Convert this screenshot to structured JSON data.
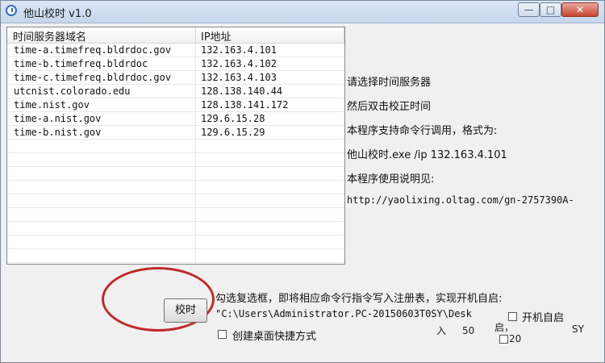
{
  "window": {
    "title": "他山校时 v1.0",
    "controls": {
      "minimize": "—",
      "maximize": "□",
      "close": "✕"
    }
  },
  "table": {
    "headers": [
      "时间服务器域名",
      "IP地址"
    ],
    "rows": [
      [
        "time-a.timefreq.bldrdoc.gov",
        "132.163.4.101"
      ],
      [
        "time-b.timefreq.bldrdoc",
        "132.163.4.102"
      ],
      [
        "time-c.timefreq.bldrdoc.gov",
        "132.163.4.103"
      ],
      [
        "utcnist.colorado.edu",
        "128.138.140.44"
      ],
      [
        "time.nist.gov",
        "128.138.141.172"
      ],
      [
        "time-a.nist.gov",
        "129.6.15.28"
      ],
      [
        "time-b.nist.gov",
        "129.6.15.29"
      ]
    ]
  },
  "info": {
    "line1": "请选择时间服务器",
    "line2": "然后双击校正时间",
    "line3": "本程序支持命令行调用，格式为:",
    "line4": "他山校时.exe /ip 132.163.4.101",
    "line5": "本程序使用说明见:",
    "url": "http://yaolixing.oltag.com/gn-2757390A-"
  },
  "bottom": {
    "sync_button": "校时",
    "hint": "勾选复选框，即将相应命令行指令写入注册表，实现开机自启:",
    "command": "\"C:\\Users\\Administrator.PC-20150603T0SY\\Desk",
    "autostart_label": "开机自启",
    "shortcut_label": "创建桌面快捷方式",
    "frag_a": "入",
    "frag_b": "50",
    "frag_c": "启，",
    "frag_d": "20",
    "frag_e": "SY"
  }
}
